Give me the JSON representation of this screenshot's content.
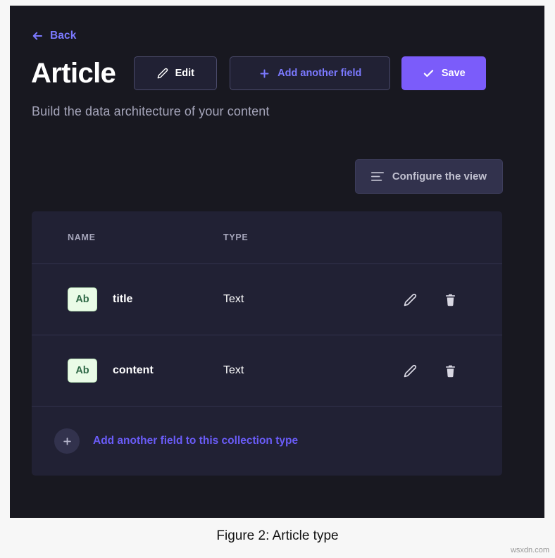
{
  "app": {
    "back": {
      "label": "Back",
      "icon": "arrow-left-icon",
      "color": "#7b79ff"
    },
    "title": "Article",
    "subtitle": "Build the data architecture of your content",
    "header_buttons": {
      "edit": {
        "label": "Edit",
        "icon": "pencil-icon"
      },
      "add_another_field": {
        "label": "Add another field",
        "icon": "plus-icon"
      },
      "save": {
        "label": "Save",
        "icon": "check-icon",
        "color": "#7b5cfa"
      }
    },
    "configure_view": {
      "label": "Configure the view",
      "icon": "list-lines-icon"
    },
    "table": {
      "columns": [
        "NAME",
        "TYPE",
        ""
      ],
      "rows": [
        {
          "badge": "Ab",
          "name": "title",
          "type": "Text",
          "edit_icon": "pencil-icon",
          "delete_icon": "trash-icon"
        },
        {
          "badge": "Ab",
          "name": "content",
          "type": "Text",
          "edit_icon": "pencil-icon",
          "delete_icon": "trash-icon"
        }
      ]
    },
    "add_field_footer": {
      "label": "Add another field to this collection type",
      "icon": "plus-circle-icon",
      "color": "#6a5cf8"
    },
    "colors": {
      "background": "#181820",
      "card": "#212134",
      "accent": "#7b79ff",
      "primary": "#7b5cfa",
      "badge_bg": "#eafbe7",
      "badge_text": "#2f6846",
      "divider": "#32324d"
    }
  },
  "caption": "Figure 2: Article type",
  "watermark": "wsxdn.com"
}
